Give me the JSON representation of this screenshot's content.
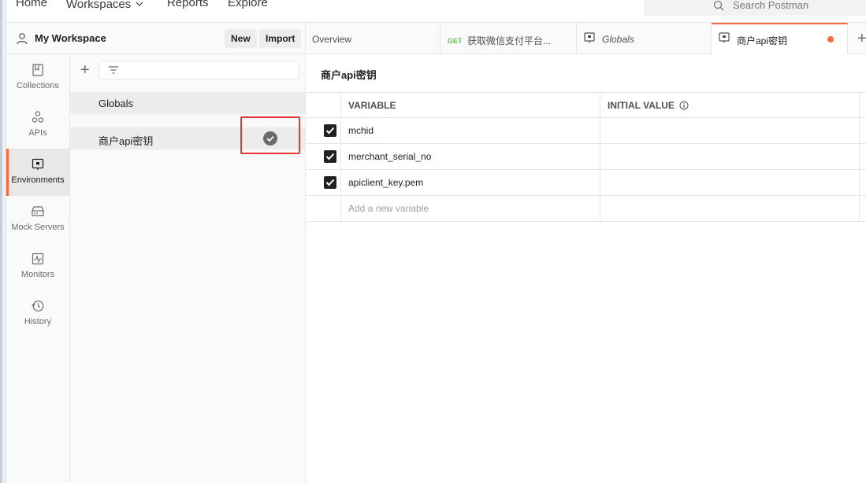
{
  "topnav": {
    "home": "Home",
    "workspaces": "Workspaces",
    "reports": "Reports",
    "explore": "Explore",
    "search_placeholder": "Search Postman"
  },
  "workspace": {
    "title": "My Workspace",
    "new_label": "New",
    "import_label": "Import"
  },
  "sidebar": {
    "items": [
      {
        "label": "Collections",
        "icon": "collections-icon"
      },
      {
        "label": "APIs",
        "icon": "apis-icon"
      },
      {
        "label": "Environments",
        "icon": "environments-icon",
        "active": true
      },
      {
        "label": "Mock Servers",
        "icon": "mock-servers-icon"
      },
      {
        "label": "Monitors",
        "icon": "monitors-icon"
      },
      {
        "label": "History",
        "icon": "history-icon"
      }
    ]
  },
  "environments": {
    "items": [
      {
        "name": "Globals"
      },
      {
        "name": "商户api密钥",
        "active": true
      }
    ]
  },
  "tabs": [
    {
      "label": "Overview"
    },
    {
      "method": "GET",
      "label": "获取微信支付平台..."
    },
    {
      "label": "Globals"
    },
    {
      "label": "商户api密钥",
      "active": true,
      "unsaved": true
    }
  ],
  "main": {
    "title": "商户api密钥",
    "columns": [
      "VARIABLE",
      "INITIAL VALUE"
    ],
    "rows": [
      {
        "variable": "mchid",
        "initial": "",
        "checked": true
      },
      {
        "variable": "merchant_serial_no",
        "initial": "",
        "checked": true
      },
      {
        "variable": "apiclient_key.pem",
        "initial": "",
        "checked": true
      }
    ],
    "new_variable_placeholder": "Add a new variable"
  },
  "colors": {
    "accent": "#f26b3a",
    "highlight": "#e53935",
    "get_method": "#6bbd5b"
  }
}
